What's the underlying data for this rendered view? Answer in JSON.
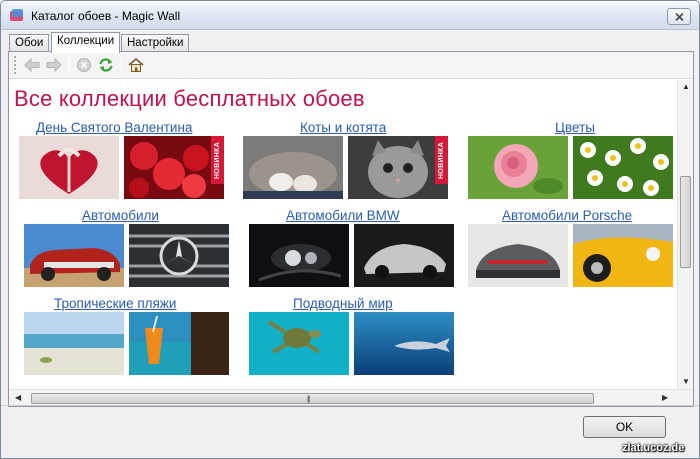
{
  "window": {
    "title": "Каталог обоев - Magic Wall"
  },
  "tabs": [
    {
      "label": "Обои"
    },
    {
      "label": "Коллекции"
    },
    {
      "label": "Настройки"
    }
  ],
  "toolbar": {
    "icons": [
      "back-arrow-icon",
      "forward-arrow-icon",
      "stop-icon",
      "refresh-icon",
      "home-icon"
    ]
  },
  "page": {
    "heading": "Все коллекции бесплатных обоев"
  },
  "collections": [
    {
      "title": "День Святого Валентина",
      "thumbs": [
        "heart box with ribbon",
        "red hearts"
      ],
      "badge": "НОВИНКА"
    },
    {
      "title": "Коты и котята",
      "thumbs": [
        "kitten paws",
        "grey kitten"
      ],
      "badge": "НОВИНКА"
    },
    {
      "title": "Цветы",
      "thumbs": [
        "pink rose",
        "white daisies"
      ]
    },
    {
      "title": "Автомобили",
      "thumbs": [
        "classic car",
        "mercedes grille"
      ]
    },
    {
      "title": "Автомобили BMW",
      "thumbs": [
        "bmw headlight",
        "bmw concept"
      ]
    },
    {
      "title": "Автомобили Porsche",
      "thumbs": [
        "porsche rear",
        "yellow porsche"
      ]
    },
    {
      "title": "Тропические пляжи",
      "thumbs": [
        "tropical beach",
        "cocktail"
      ]
    },
    {
      "title": "Подводный мир",
      "thumbs": [
        "sea turtle",
        "shark"
      ]
    }
  ],
  "footer": {
    "ok_label": "OK"
  },
  "watermark": "zlat.ucoz.de"
}
